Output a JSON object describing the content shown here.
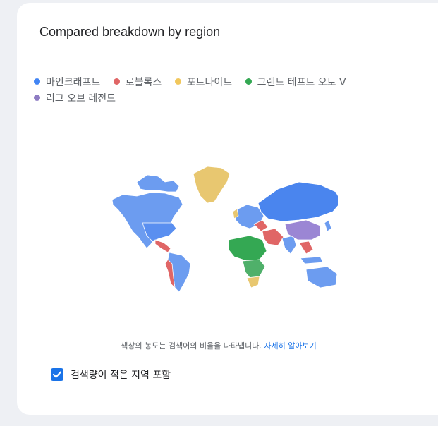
{
  "card": {
    "title": "Compared breakdown by region"
  },
  "legend": [
    {
      "label": "마인크래프트",
      "color": "#4285f4"
    },
    {
      "label": "로블록스",
      "color": "#e06666"
    },
    {
      "label": "포트나이트",
      "color": "#f1c75c"
    },
    {
      "label": "그랜드 테프트 오토 V",
      "color": "#34a853"
    },
    {
      "label": "리그 오브 레전드",
      "color": "#8e7cc3"
    }
  ],
  "note": {
    "text": "색상의 농도는 검색어의 비율을 나타냅니다.",
    "link": "자세히 알아보기"
  },
  "checkbox": {
    "label": "검색량이 적은 지역 포함",
    "checked": true
  }
}
